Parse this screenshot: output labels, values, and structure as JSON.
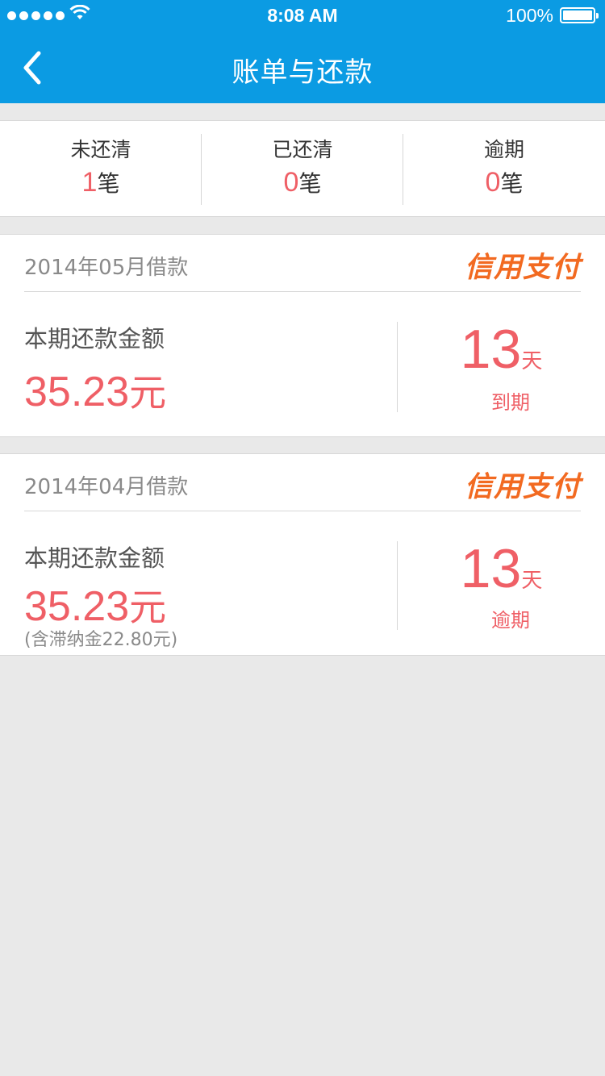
{
  "status_bar": {
    "time": "8:08 AM",
    "battery": "100%"
  },
  "nav": {
    "title": "账单与还款"
  },
  "summary": {
    "unpaid": {
      "label": "未还清",
      "count": "1",
      "unit": "笔"
    },
    "paid": {
      "label": "已还清",
      "count": "0",
      "unit": "笔"
    },
    "overdue": {
      "label": "逾期",
      "count": "0",
      "unit": "笔"
    }
  },
  "loans": [
    {
      "date": "2014年05月借款",
      "brand": "信用支付",
      "amount_label": "本期还款金额",
      "amount": "35.23",
      "amount_unit": "元",
      "days": "13",
      "days_unit": "天",
      "status": "到期"
    },
    {
      "date": "2014年04月借款",
      "brand": "信用支付",
      "amount_label": "本期还款金额",
      "amount": "35.23",
      "amount_unit": "元",
      "late_fee_note": "(含滞纳金22.80元)",
      "days": "13",
      "days_unit": "天",
      "status": "逾期"
    }
  ],
  "colors": {
    "header": "#0b9be3",
    "accent_red": "#ef5f66",
    "brand_orange": "#f26a21",
    "background": "#e9e9e9"
  }
}
